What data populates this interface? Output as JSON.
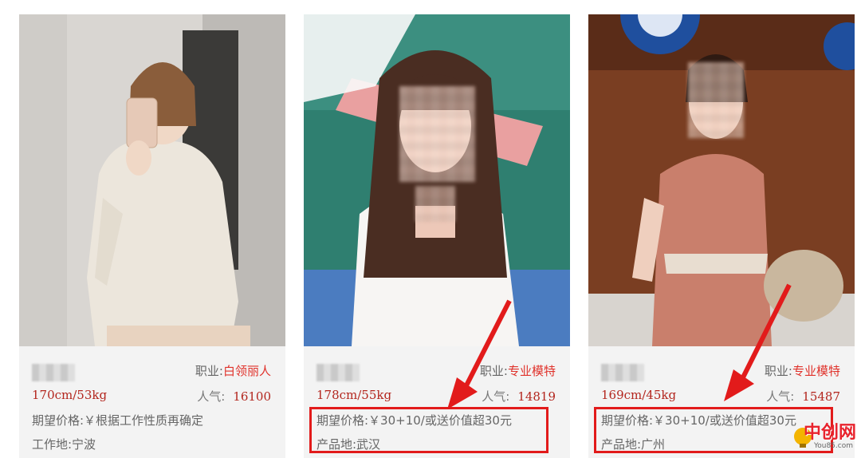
{
  "cards": [
    {
      "job_label": "职业:",
      "job_value": "白领丽人",
      "height_weight": "170cm/53kg",
      "popularity_label": "人气:",
      "popularity_value": "16100",
      "price": "期望价格:￥根据工作性质再确定",
      "place": "工作地:宁波"
    },
    {
      "job_label": "职业:",
      "job_value": "专业模特",
      "height_weight": "178cm/55kg",
      "popularity_label": "人气:",
      "popularity_value": "14819",
      "price": "期望价格:￥30+10/或送价值超30元",
      "place": "产品地:武汉"
    },
    {
      "job_label": "职业:",
      "job_value": "专业模特",
      "height_weight": "169cm/45kg",
      "popularity_label": "人气:",
      "popularity_value": "15487",
      "price": "期望价格:￥30+10/或送价值超30元",
      "place": "产品地:广州"
    }
  ],
  "watermark": {
    "title": "中创网",
    "sub": "You85.com"
  },
  "colors": {
    "accent": "#e0322b",
    "highlight_box": "#e21b1b"
  }
}
